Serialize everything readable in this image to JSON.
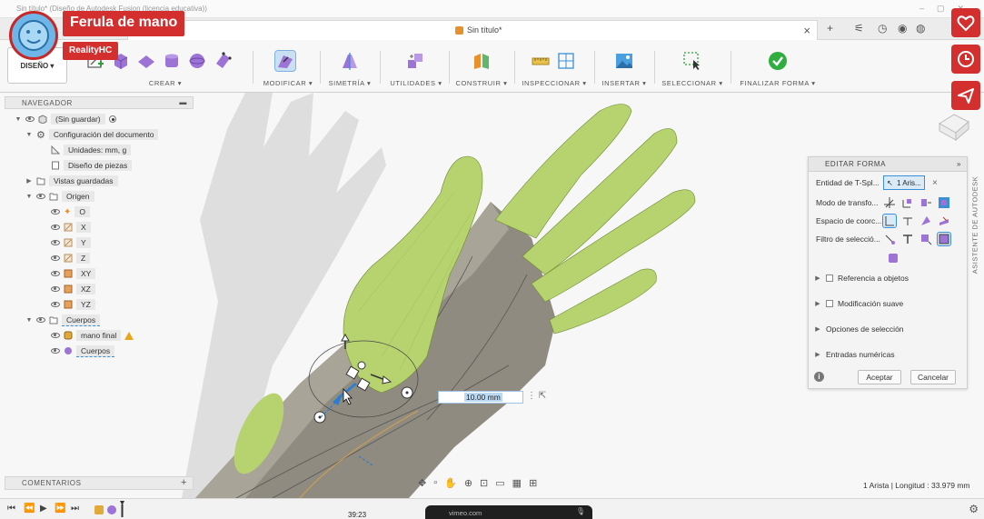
{
  "window": {
    "title": "Sin título* (Diseño de Autodesk Fusion (licencia educativa))"
  },
  "tab": {
    "title": "Sin título*"
  },
  "toolbar": {
    "design_label": "DISEÑO ▾",
    "groups": {
      "crear": "CREAR ▾",
      "modificar": "MODIFICAR ▾",
      "simetria": "SIMETRÍA ▾",
      "utilidades": "UTILIDADES ▾",
      "construir": "CONSTRUIR ▾",
      "inspeccionar": "INSPECCIONAR ▾",
      "insertar": "INSERTAR ▾",
      "seleccionar": "SELECCIONAR ▾",
      "finalizar": "FINALIZAR FORMA ▾"
    }
  },
  "navigator": {
    "title": "NAVEGADOR",
    "root": "(Sin guardar)",
    "doc_settings": "Configuración del documento",
    "units": "Unidades: mm, g",
    "part_design": "Diseño de piezas",
    "saved_views": "Vistas guardadas",
    "origin": "Origen",
    "origin_items": [
      "O",
      "X",
      "Y",
      "Z",
      "XY",
      "XZ",
      "YZ"
    ],
    "bodies": "Cuerpos",
    "body_items": [
      "mano final",
      "Cuerpos"
    ]
  },
  "comments": {
    "title": "COMENTARIOS"
  },
  "edit_form": {
    "title": "EDITAR FORMA",
    "entity_label": "Entidad de T-Spl...",
    "entity_value": "1 Aris...",
    "transform_label": "Modo de transfo...",
    "coord_label": "Espacio de coorc...",
    "filter_label": "Filtro de selecció...",
    "sections": [
      "Referencia a objetos",
      "Modificación suave",
      "Opciones de selección",
      "Entradas numéricas"
    ],
    "accept": "Aceptar",
    "cancel": "Cancelar"
  },
  "side_tab": "ASISTENTE DE AUTODESK",
  "length_input": {
    "value": "10.00 mm"
  },
  "status": "1 Arista | Longitud : 33.979 mm",
  "video_overlay": {
    "title": "Ferula de mano",
    "author": "RealityHC",
    "vimeo": "vimeo.com",
    "time": "39:23"
  },
  "colors": {
    "accent_blue": "#3b8fd8",
    "mesh_green": "#b7d36f",
    "shell_gray": "#8f8b80",
    "overlay_red": "#d32f2f"
  }
}
